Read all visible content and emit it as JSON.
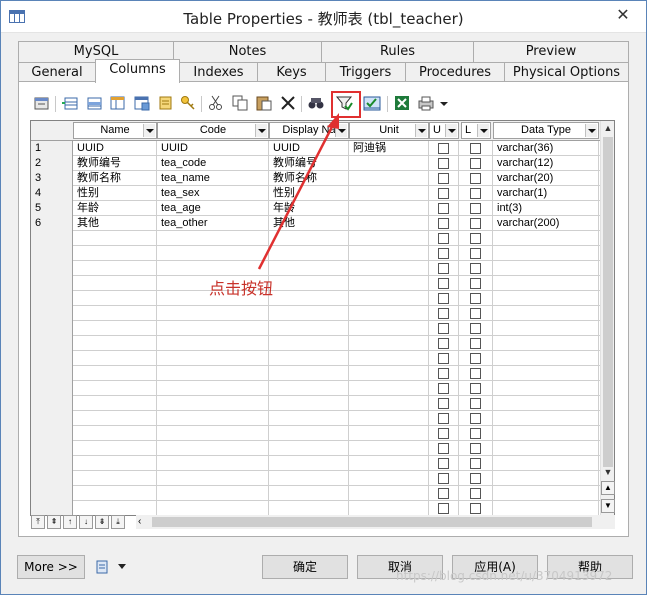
{
  "window": {
    "title": "Table Properties - 教师表 (tbl_teacher)",
    "close_label": "✕"
  },
  "tabs_top": [
    "MySQL",
    "Notes",
    "Rules",
    "Preview"
  ],
  "tabs_bottom": [
    "General",
    "Columns",
    "Indexes",
    "Keys",
    "Triggers",
    "Procedures",
    "Physical Options"
  ],
  "active_tab": "Columns",
  "toolbar": {
    "icons": [
      "properties-icon",
      "add-row-icon",
      "insert-row-icon",
      "add-columns-icon",
      "reuse-columns-icon",
      "new-domain-icon",
      "cut-icon",
      "copy-icon",
      "paste-icon",
      "delete-icon",
      "find-icon",
      "filter-icon",
      "customize-columns-icon",
      "excel-icon",
      "print-icon",
      "more-dropdown-icon"
    ]
  },
  "columns": {
    "headers": [
      "Name",
      "Code",
      "Display Na",
      "Unit",
      "U",
      "L",
      "Data Type"
    ],
    "rows": [
      {
        "n": "1",
        "name": "UUID",
        "code": "UUID",
        "display": "UUID",
        "unit": "阿迪锅",
        "type": "varchar(36)"
      },
      {
        "n": "2",
        "name": "教师编号",
        "code": "tea_code",
        "display": "教师编号",
        "unit": "",
        "type": "varchar(12)"
      },
      {
        "n": "3",
        "name": "教师名称",
        "code": "tea_name",
        "display": "教师名称",
        "unit": "",
        "type": "varchar(20)"
      },
      {
        "n": "4",
        "name": "性别",
        "code": "tea_sex",
        "display": "性别",
        "unit": "",
        "type": "varchar(1)"
      },
      {
        "n": "5",
        "name": "年龄",
        "code": "tea_age",
        "display": "年龄",
        "unit": "",
        "type": "int(3)"
      },
      {
        "n": "6",
        "name": "其他",
        "code": "tea_other",
        "display": "其他",
        "unit": "",
        "type": "varchar(200)"
      }
    ]
  },
  "annotation": "点击按钮",
  "buttons": {
    "more": "More >>",
    "ok": "确定",
    "cancel": "取消",
    "apply": "应用(A)",
    "help": "帮助"
  },
  "watermark": "https://blog.csdn.net/u/3704913972",
  "colors": {
    "highlight": "#e03030",
    "annotation": "#c8322a"
  }
}
